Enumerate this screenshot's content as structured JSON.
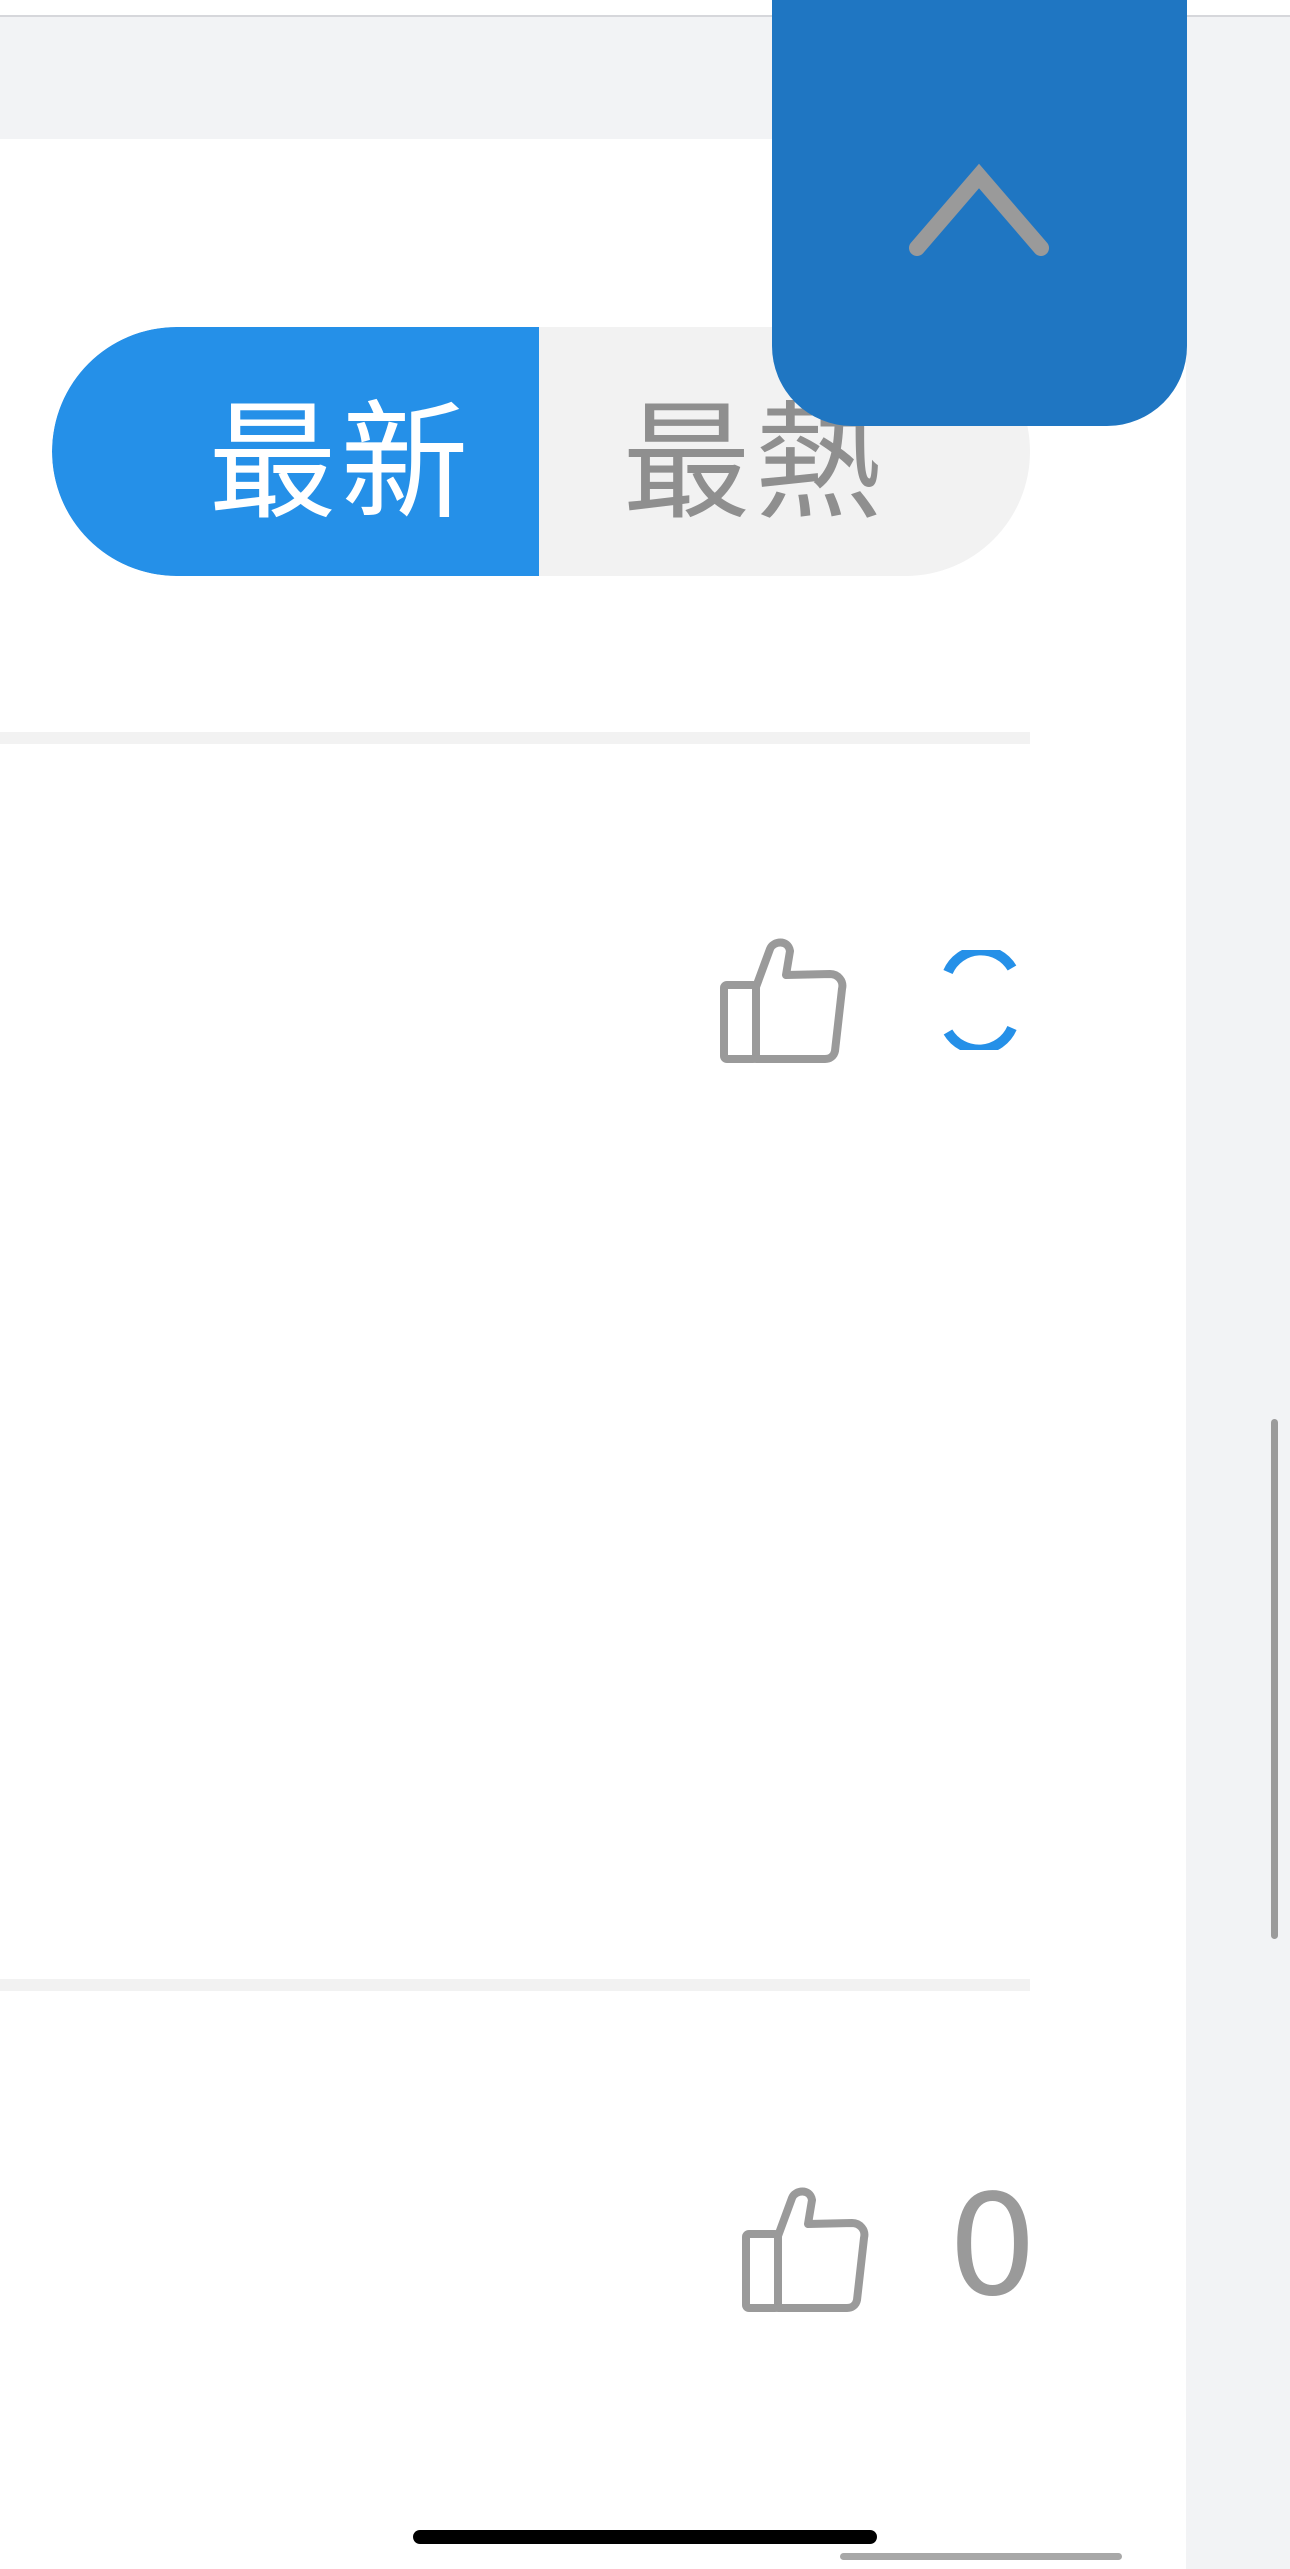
{
  "tabs": {
    "latest_label": "最新",
    "hot_label": "最熱",
    "selected": "latest"
  },
  "comments": [
    {
      "like_icon": "thumbs-up-icon",
      "like_count_state": "loading-spinner"
    },
    {
      "like_icon": "thumbs-up-icon",
      "like_count": "0"
    }
  ],
  "floating": {
    "icon": "chevron-up-icon"
  },
  "colors": {
    "accent": "#2590e8",
    "button": "#1f76c2",
    "icon_gray": "#9a9a9a",
    "background_gray": "#f2f3f5"
  }
}
